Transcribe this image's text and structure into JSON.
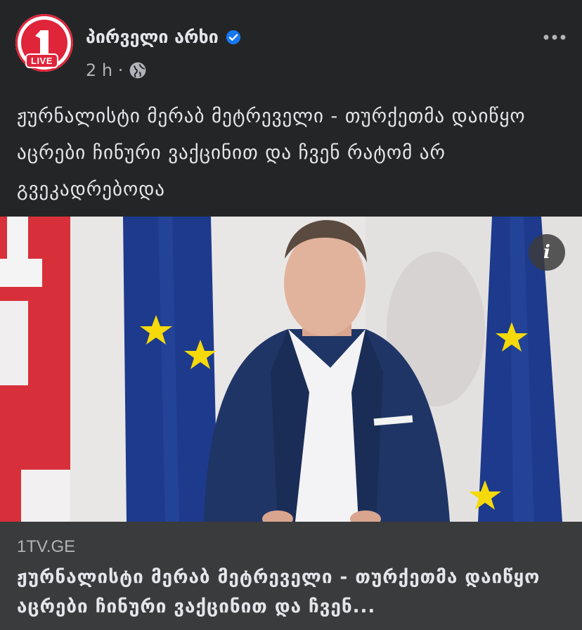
{
  "page": {
    "name": "პირველი არხი",
    "live_badge": "LIVE",
    "timestamp": "2 h ·",
    "verified": true
  },
  "post": {
    "text": "ჟურნალისტი მერაბ მეტრეველი - თურქეთმა დაიწყო აცრები ჩინური ვაქცინით და ჩვენ რატომ არ გვეკადრებოდა"
  },
  "media": {
    "info_label": "i"
  },
  "link_preview": {
    "domain": "1TV.GE",
    "title": "ჟურნალისტი მერაბ მეტრეველი - თურქეთმა დაიწყო აცრები ჩინური ვაქცინით და ჩვენ..."
  },
  "colors": {
    "background": "#242526",
    "preview_background": "#3a3b3c",
    "brand_red": "#e0243a",
    "verified_blue": "#1877f2"
  },
  "icons": {
    "more": "more-dots-icon",
    "privacy": "globe-icon",
    "verified": "verified-badge-icon",
    "info": "info-icon"
  }
}
